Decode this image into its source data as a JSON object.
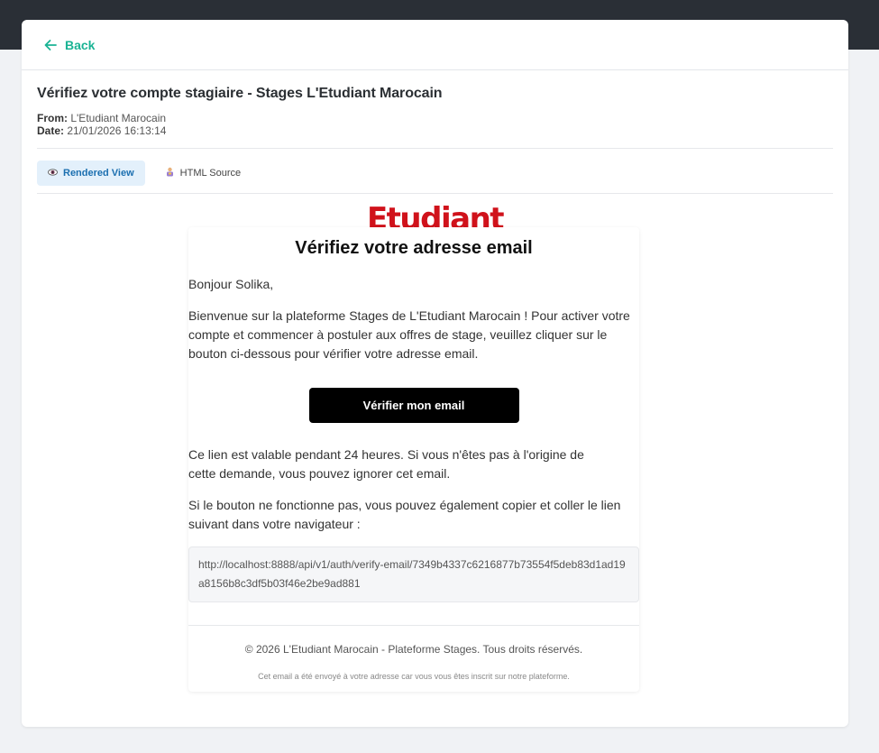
{
  "back": {
    "label": "Back"
  },
  "message": {
    "subject": "Vérifiez votre compte stagiaire - Stages L'Etudiant Marocain",
    "from_label": "From:",
    "from_value": "L'Etudiant Marocain",
    "date_label": "Date:",
    "date_value": "21/01/2026 16:13:14"
  },
  "tabs": [
    {
      "label": "Rendered View",
      "icon": "eye-icon",
      "active": true
    },
    {
      "label": "HTML Source",
      "icon": "code-icon",
      "active": false
    }
  ],
  "email": {
    "logo_text": "Etudiant",
    "title": "Vérifiez votre adresse email",
    "greeting": "Bonjour Solika,",
    "intro": "Bienvenue sur la plateforme Stages de L'Etudiant Marocain ! Pour activer votre compte et commencer à postuler aux offres de stage, veuillez cliquer sur le bouton ci-dessous pour vérifier votre adresse email.",
    "button_label": "Vérifier mon email",
    "validity": "Ce lien est valable pendant 24 heures. Si vous n'êtes pas à l'origine de cette demande, vous pouvez ignorer cet email.",
    "fallback": "Si le bouton ne fonctionne pas, vous pouvez également copier et coller le lien suivant dans votre navigateur :",
    "link": "http://localhost:8888/api/v1/auth/verify-email/7349b4337c6216877b73554f5deb83d1ad19a8156b8c3df5b03f46e2be9ad881",
    "copyright": "© 2026 L'Etudiant Marocain - Plateforme Stages. Tous droits réservés.",
    "note": "Cet email a été envoyé à votre adresse car vous vous êtes inscrit sur notre plateforme."
  },
  "colors": {
    "accent": "#1ab394",
    "brand_red": "#d0121b",
    "tab_active_bg": "#e3f0fb",
    "tab_active_text": "#1b6fb0",
    "topbar": "#2a2f36"
  }
}
